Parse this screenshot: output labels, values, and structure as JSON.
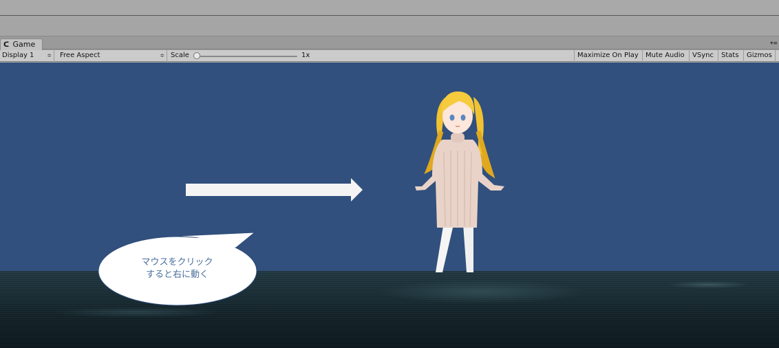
{
  "tab": {
    "label": "Game",
    "icon": "pacman-icon"
  },
  "toolbar": {
    "display": "Display 1",
    "aspect": "Free Aspect",
    "scale_label": "Scale",
    "scale_value": "1x",
    "scale_fraction": 0.02,
    "maximize": "Maximize On Play",
    "mute": "Mute Audio",
    "vsync": "VSync",
    "stats": "Stats",
    "gizmos": "Gizmos"
  },
  "scene": {
    "bubble_line1": "マウスをクリック",
    "bubble_line2": "すると右に動く",
    "background_color": "#31507d"
  }
}
